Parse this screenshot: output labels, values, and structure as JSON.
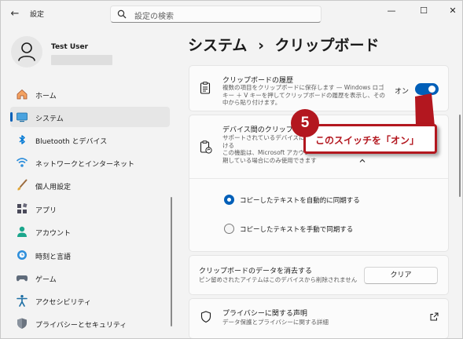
{
  "titlebar": {
    "back_glyph": "←",
    "app_title": "設定",
    "search_placeholder": "設定の検索",
    "minimize_glyph": "—",
    "maximize_glyph": "☐",
    "close_glyph": "✕"
  },
  "user": {
    "name": "Test User"
  },
  "sidebar": {
    "items": [
      {
        "label": "ホーム",
        "icon": "home-icon"
      },
      {
        "label": "システム",
        "icon": "system-icon",
        "selected": true
      },
      {
        "label": "Bluetooth とデバイス",
        "icon": "bluetooth-icon"
      },
      {
        "label": "ネットワークとインターネット",
        "icon": "network-icon"
      },
      {
        "label": "個人用設定",
        "icon": "personalization-icon"
      },
      {
        "label": "アプリ",
        "icon": "apps-icon"
      },
      {
        "label": "アカウント",
        "icon": "accounts-icon"
      },
      {
        "label": "時刻と言語",
        "icon": "time-language-icon"
      },
      {
        "label": "ゲーム",
        "icon": "gaming-icon"
      },
      {
        "label": "アクセシビリティ",
        "icon": "accessibility-icon"
      },
      {
        "label": "プライバシーとセキュリティ",
        "icon": "privacy-icon"
      }
    ]
  },
  "page": {
    "title_parent": "システム",
    "title_separator": "›",
    "title_current": "クリップボード"
  },
  "history_card": {
    "title": "クリップボードの履歴",
    "desc_line1": "複数の項目をクリップボードに保存します — Windows ロゴ",
    "desc_line2": "キー ＋ V キーを押してクリップボードの履歴を表示し、その",
    "desc_line3": "中から貼り付けます。",
    "toggle_state_label": "オン",
    "toggle_on": true
  },
  "sync_card": {
    "title": "デバイス間のクリップボー",
    "desc_line1": "サポートされているデバイスに P",
    "desc_line2": "ける",
    "desc_line3": "この機能は、Microsoft アカウン",
    "desc_line4": "期している場合にのみ使用できます",
    "options": [
      {
        "label": "コピーしたテキストを自動的に同期する",
        "selected": true
      },
      {
        "label": "コピーしたテキストを手動で同期する",
        "selected": false
      }
    ]
  },
  "clear_card": {
    "title": "クリップボードのデータを消去する",
    "desc": "ピン留めされたアイテムはこのデバイスから削除されません",
    "button_label": "クリア"
  },
  "privacy_card": {
    "title": "プライバシーに関する声明",
    "desc": "データ保護とプライバシーに関する詳細"
  },
  "callout": {
    "number": "5",
    "text": "このスイッチを「オン」"
  },
  "colors": {
    "accent": "#005fb8",
    "callout": "#b3171f"
  }
}
